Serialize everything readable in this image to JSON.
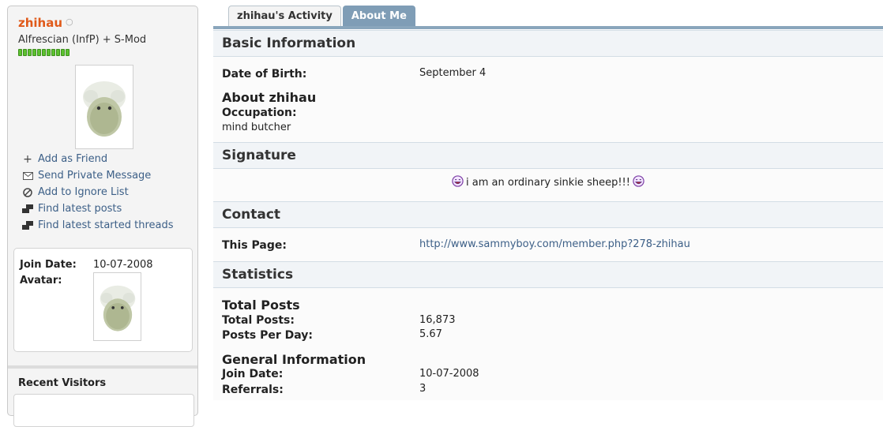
{
  "profile": {
    "username": "zhihau",
    "online_status": "○",
    "usertitle": "Alfrescian (InfP) + S-Mod",
    "reputation_pips": 11
  },
  "actions": [
    {
      "label": "Add as Friend",
      "icon": "plus-icon"
    },
    {
      "label": "Send Private Message",
      "icon": "envelope-icon"
    },
    {
      "label": "Add to Ignore List",
      "icon": "ignore-icon"
    },
    {
      "label": "Find latest posts",
      "icon": "posts-icon"
    },
    {
      "label": "Find latest started threads",
      "icon": "threads-icon"
    }
  ],
  "mini_stats": {
    "join_date_label": "Join Date:",
    "join_date_value": "10-07-2008",
    "avatar_label": "Avatar:"
  },
  "recent_visitors": {
    "title": "Recent Visitors"
  },
  "tabs": [
    {
      "label": "zhihau's Activity",
      "active": false
    },
    {
      "label": "About Me",
      "active": true
    }
  ],
  "basic_info": {
    "title": "Basic Information",
    "dob_label": "Date of Birth:",
    "dob_value": "September 4",
    "about_title": "About zhihau",
    "occupation_label": "Occupation:",
    "occupation_value": "mind butcher"
  },
  "signature": {
    "title": "Signature",
    "text": "i am an ordinary sinkie sheep!!!"
  },
  "contact": {
    "title": "Contact",
    "page_label": "This Page:",
    "page_url": "http://www.sammyboy.com/member.php?278-zhihau"
  },
  "statistics": {
    "title": "Statistics",
    "total_posts_title": "Total Posts",
    "total_posts_label": "Total Posts:",
    "total_posts_value": "16,873",
    "ppd_label": "Posts Per Day:",
    "ppd_value": "5.67",
    "general_title": "General Information",
    "join_label": "Join Date:",
    "join_value": "10-07-2008",
    "referrals_label": "Referrals:",
    "referrals_value": "3"
  },
  "colors": {
    "username": "#e05a1a",
    "link": "#3c5f87",
    "active_tab": "#7f9db6",
    "reputation": "#5cc12f"
  }
}
